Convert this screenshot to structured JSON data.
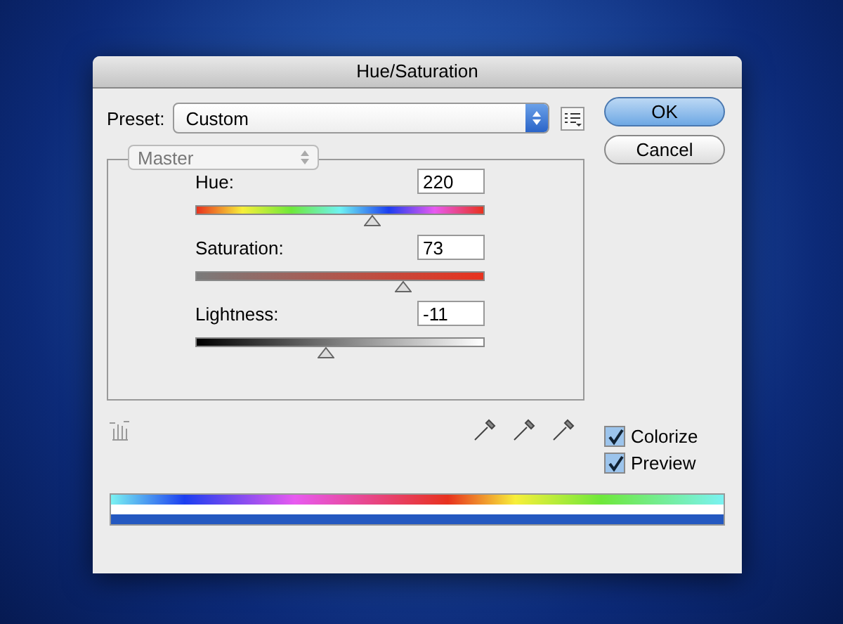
{
  "window": {
    "title": "Hue/Saturation"
  },
  "preset": {
    "label": "Preset:",
    "value": "Custom"
  },
  "buttons": [
    {
      "label": "OK",
      "kind": "default"
    },
    {
      "label": "Cancel",
      "kind": "normal"
    }
  ],
  "channel": {
    "value": "Master",
    "disabled": true
  },
  "sliders": [
    {
      "label": "Hue:",
      "value": "220",
      "kind": "hue",
      "level": 0.61
    },
    {
      "label": "Saturation:",
      "value": "73",
      "kind": "saturation",
      "level": 0.72
    },
    {
      "label": "Lightness:",
      "value": "-11",
      "kind": "lightness",
      "level": 0.45
    }
  ],
  "checkboxes": [
    {
      "label": "Colorize",
      "checked": true
    },
    {
      "label": "Preview",
      "checked": true
    }
  ]
}
